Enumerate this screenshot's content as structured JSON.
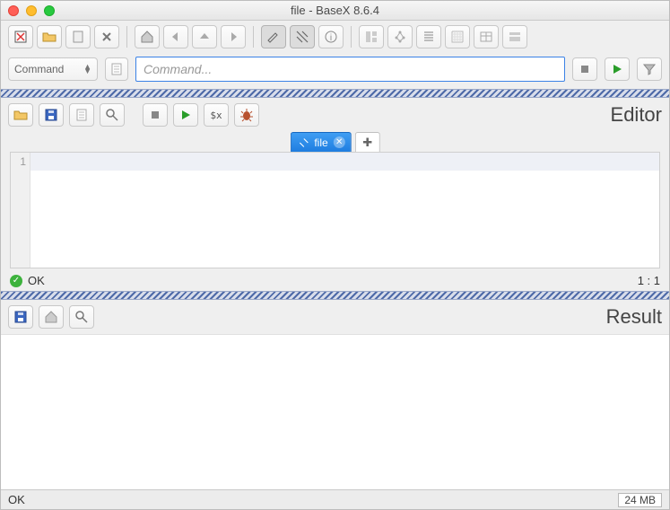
{
  "window": {
    "title": "file - BaseX 8.6.4"
  },
  "cmd": {
    "mode_label": "Command",
    "placeholder": "Command..."
  },
  "editor": {
    "panel_title": "Editor",
    "tab_label": "file",
    "line_number": "1",
    "status_text": "OK",
    "cursor_pos": "1 : 1"
  },
  "result": {
    "panel_title": "Result"
  },
  "bottom": {
    "status": "OK",
    "memory": "24 MB"
  }
}
